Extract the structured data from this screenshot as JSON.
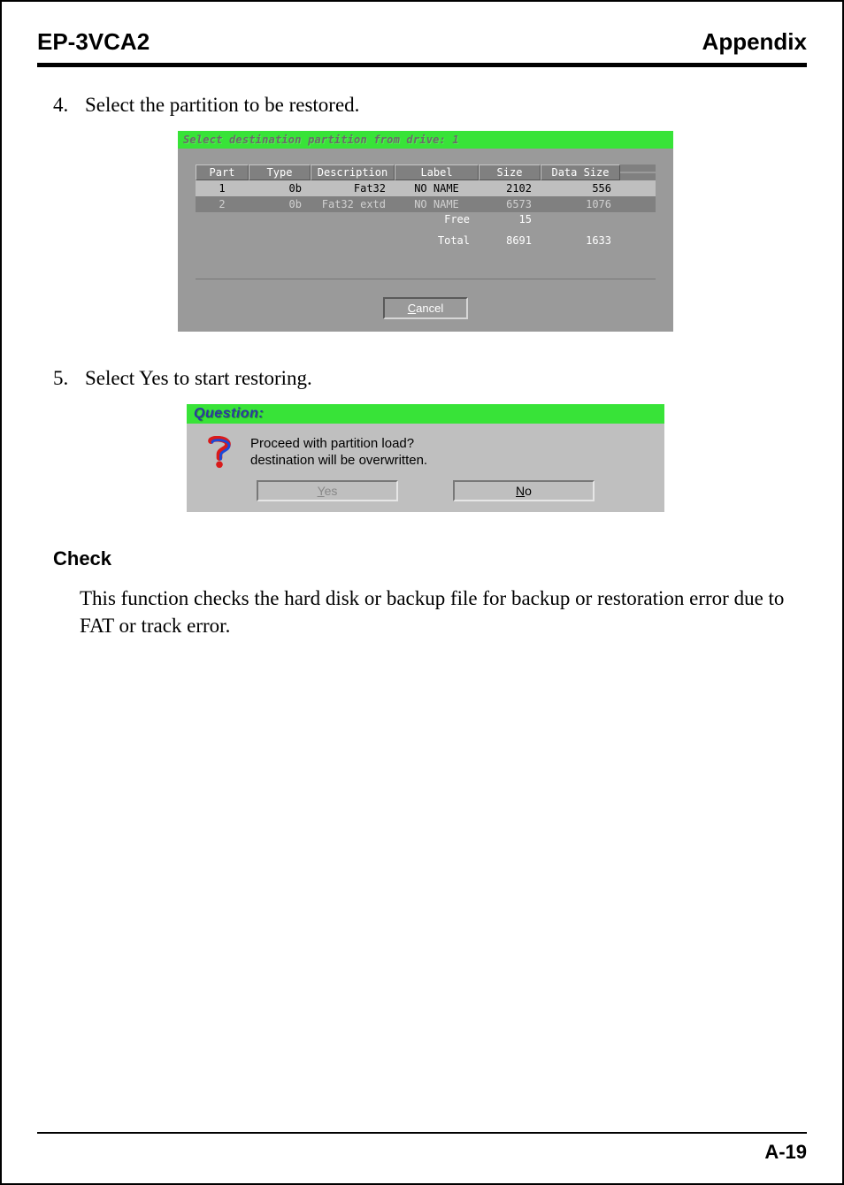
{
  "header": {
    "left": "EP-3VCA2",
    "right": "Appendix"
  },
  "step4": {
    "num": "4.",
    "text": "Select the partition to be restored."
  },
  "win1": {
    "title": "Select destination partition from drive: 1",
    "headers": {
      "part": "Part",
      "type": "Type",
      "desc": "Description",
      "label": "Label",
      "size": "Size",
      "data": "Data Size"
    },
    "rows": [
      {
        "part": "1",
        "type": "0b",
        "desc": "Fat32",
        "label": "NO NAME",
        "size": "2102",
        "data": "556"
      },
      {
        "part": "2",
        "type": "0b",
        "desc": "Fat32 extd",
        "label": "NO NAME",
        "size": "6573",
        "data": "1076"
      }
    ],
    "free": {
      "label": "Free",
      "size": "15"
    },
    "total": {
      "label": "Total",
      "size": "8691",
      "data": "1633"
    },
    "cancel_prefix": "C",
    "cancel_rest": "ancel"
  },
  "step5": {
    "num": "5.",
    "text": "Select Yes to start restoring."
  },
  "win2": {
    "title": "Question:",
    "msg1": "Proceed with partition load?",
    "msg2": "destination will be overwritten.",
    "yes_prefix": "Y",
    "yes_rest": "es",
    "no_prefix": "N",
    "no_rest": "o"
  },
  "check": {
    "head": "Check",
    "body": "This function checks the hard disk or backup file for backup or restoration error due to FAT or track error."
  },
  "footer": {
    "page": "A-19"
  }
}
